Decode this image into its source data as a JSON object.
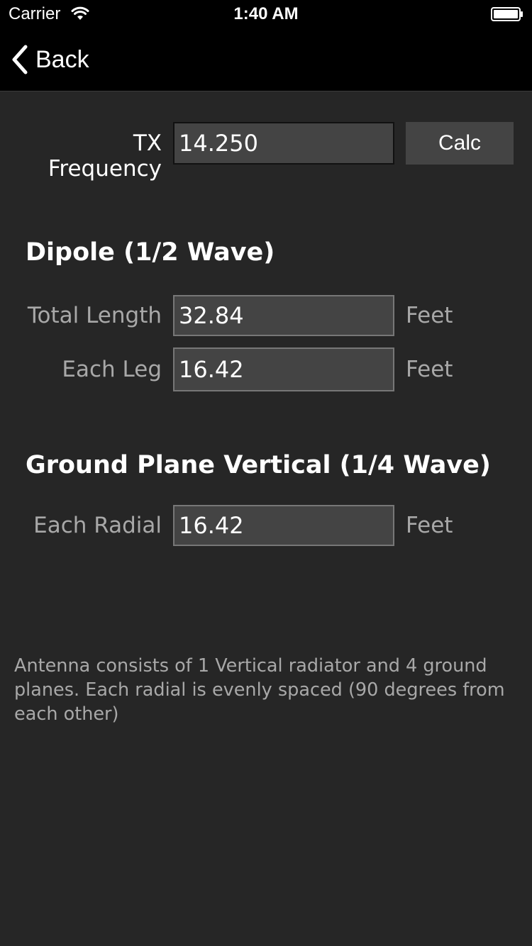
{
  "status_bar": {
    "carrier": "Carrier",
    "time": "1:40 AM"
  },
  "nav": {
    "back_label": "Back"
  },
  "frequency": {
    "label": "TX Frequency",
    "value": "14.250",
    "calc_label": "Calc"
  },
  "dipole": {
    "heading": "Dipole (1/2 Wave)",
    "rows": [
      {
        "label": "Total Length",
        "value": "32.84",
        "unit": "Feet"
      },
      {
        "label": "Each Leg",
        "value": "16.42",
        "unit": "Feet"
      }
    ]
  },
  "ground_plane": {
    "heading": "Ground Plane Vertical (1/4 Wave)",
    "rows": [
      {
        "label": "Each Radial",
        "value": "16.42",
        "unit": "Feet"
      }
    ]
  },
  "note": "Antenna consists of 1 Vertical radiator and 4 ground planes. Each radial is evenly spaced (90 degrees from each other)"
}
